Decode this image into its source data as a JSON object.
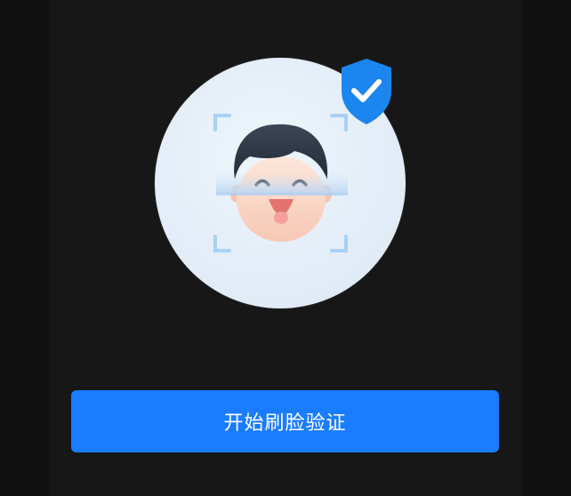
{
  "illustration": {
    "face_icon": "smiling-face-icon",
    "scan_frame_icon": "scan-frame-icon",
    "shield_icon": "shield-check-icon",
    "accent_color": "#1a7cff",
    "shield_color": "#1b86f0",
    "background_color": "#171717"
  },
  "actions": {
    "start_label": "开始刷脸验证"
  }
}
